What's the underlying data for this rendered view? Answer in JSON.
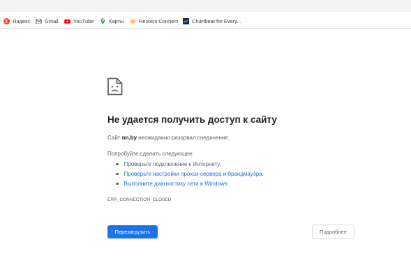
{
  "bookmarks": [
    {
      "label": "Яндекс",
      "icon": "yandex-icon",
      "color": "#fc3f1d"
    },
    {
      "label": "Gmail",
      "icon": "gmail-icon",
      "color": "#ea4335"
    },
    {
      "label": "YouTube",
      "icon": "youtube-icon",
      "color": "#ff0000"
    },
    {
      "label": "Карты",
      "icon": "maps-pin-icon",
      "color": "#34a853"
    },
    {
      "label": "Reuters Connect",
      "icon": "reuters-icon",
      "color": "#ff8000"
    },
    {
      "label": "Chartbeat for Every...",
      "icon": "chartbeat-icon",
      "color": "#1c2a4a"
    }
  ],
  "error": {
    "icon": "sad-page-icon",
    "title": "Не удается получить доступ к сайту",
    "desc_prefix": "Сайт",
    "site": "nn.by",
    "desc_suffix": "неожиданно разорвал соединение.",
    "try_label": "Попробуйте сделать следующее:",
    "suggestions": [
      {
        "text": "Проверьте подключение к Интернету.",
        "is_link": false
      },
      {
        "text": "Проверьте настройки прокси-сервера и брандмауэра.",
        "is_link": true
      },
      {
        "text": "Выполните диагностику сети в Windows",
        "is_link": true
      }
    ],
    "code": "ERR_CONNECTION_CLOSED"
  },
  "buttons": {
    "reload": "Перезагрузить",
    "details": "Подробнее"
  },
  "colors": {
    "accent": "#1a73e8",
    "text_primary": "#202124",
    "text_secondary": "#5f6368"
  }
}
